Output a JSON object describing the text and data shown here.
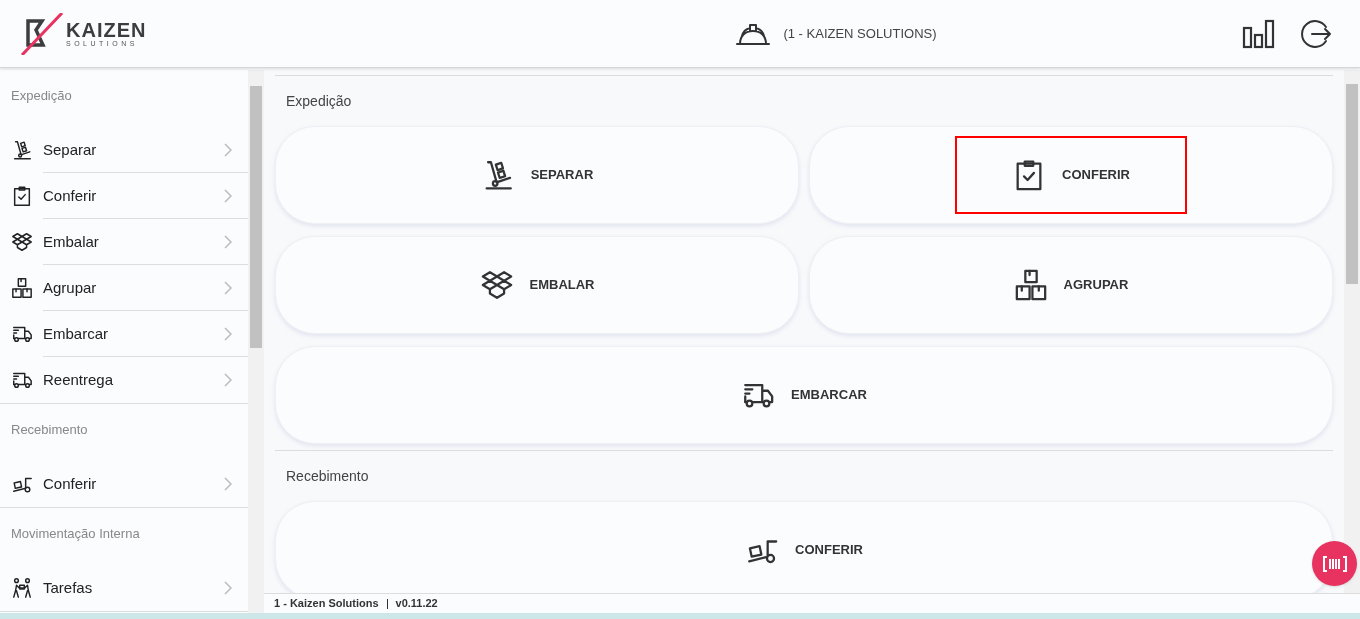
{
  "header": {
    "logo": {
      "name": "KAIZEN",
      "tagline": "SOLUTIONS"
    },
    "company": "(1 - KAIZEN SOLUTIONS)"
  },
  "sidebar": {
    "sections": [
      {
        "title": "Expedição",
        "items": [
          {
            "label": "Separar"
          },
          {
            "label": "Conferir"
          },
          {
            "label": "Embalar"
          },
          {
            "label": "Agrupar"
          },
          {
            "label": "Embarcar"
          },
          {
            "label": "Reentrega"
          }
        ]
      },
      {
        "title": "Recebimento",
        "items": [
          {
            "label": "Conferir"
          }
        ]
      },
      {
        "title": "Movimentação Interna",
        "items": [
          {
            "label": "Tarefas"
          }
        ]
      }
    ]
  },
  "main": {
    "sections": [
      {
        "title": "Expedição",
        "tiles": [
          {
            "label": "SEPARAR",
            "highlighted": false
          },
          {
            "label": "CONFERIR",
            "highlighted": true
          },
          {
            "label": "EMBALAR",
            "highlighted": false
          },
          {
            "label": "AGRUPAR",
            "highlighted": false
          },
          {
            "label": "EMBARCAR",
            "highlighted": false
          }
        ]
      },
      {
        "title": "Recebimento",
        "tiles": [
          {
            "label": "CONFERIR",
            "highlighted": false
          }
        ]
      }
    ]
  },
  "footer": {
    "company": "1 - Kaizen Solutions",
    "version": "v0.11.22"
  }
}
